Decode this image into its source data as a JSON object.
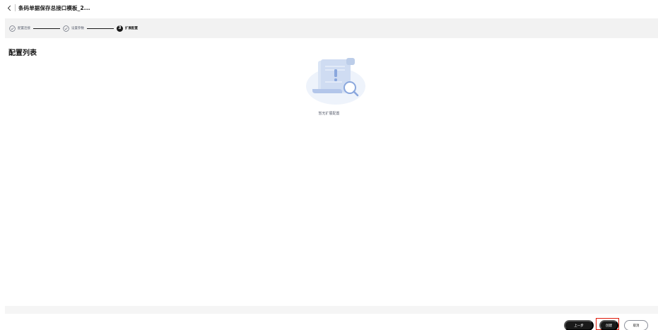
{
  "header": {
    "back_icon": "chevron-left-icon",
    "title": "条码单据保存总接口模板_2..."
  },
  "steps": [
    {
      "label": "配置连接",
      "state": "done",
      "icon": "check-circle-icon"
    },
    {
      "label": "设置参数",
      "state": "done",
      "icon": "check-circle-icon"
    },
    {
      "label": "扩展配置",
      "state": "active",
      "number": "3"
    }
  ],
  "section": {
    "title": "配置列表"
  },
  "empty": {
    "icon": "empty-document-search-illustration",
    "text": "暂无扩展配置"
  },
  "footer": {
    "prev_label": "上一步",
    "create_label": "创建",
    "cancel_label": "取消"
  },
  "colors": {
    "primary": "#191919",
    "step_bar_bg": "#f2f2f2",
    "highlight_border": "#e0190a",
    "illustration_blue": "#cfdcf2"
  }
}
